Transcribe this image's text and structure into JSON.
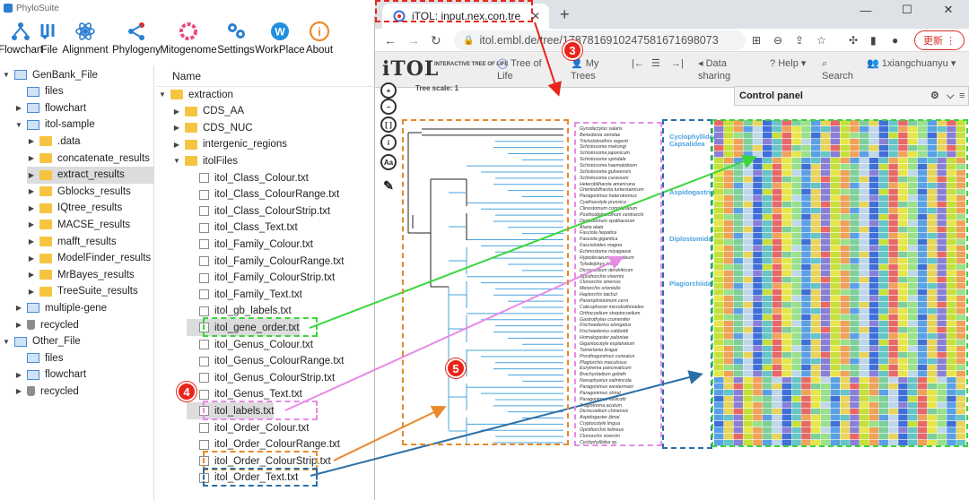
{
  "phylosuite": {
    "title": "PhyloSuite",
    "toolbar": [
      {
        "label": "Flowchart",
        "icon": "flowchart-icon"
      },
      {
        "label": "File",
        "icon": "file-icon"
      },
      {
        "label": "Alignment",
        "icon": "alignment-icon"
      },
      {
        "label": "Phylogeny",
        "icon": "phylogeny-icon"
      },
      {
        "label": "Mitogenome",
        "icon": "mitogenome-icon"
      },
      {
        "label": "Settings",
        "icon": "settings-icon"
      },
      {
        "label": "WorkPlace",
        "icon": "workplace-icon"
      },
      {
        "label": "About",
        "icon": "about-icon"
      }
    ],
    "left_tree": [
      {
        "label": "GenBank_File",
        "level": 0,
        "icon": "db",
        "expanded": true
      },
      {
        "label": "files",
        "level": 1,
        "icon": "grid"
      },
      {
        "label": "flowchart",
        "level": 1,
        "icon": "grid",
        "arrow": "collapsed"
      },
      {
        "label": "itol-sample",
        "level": 1,
        "icon": "grid",
        "expanded": true
      },
      {
        "label": ".data",
        "level": 2,
        "icon": "folder",
        "arrow": "collapsed"
      },
      {
        "label": "concatenate_results",
        "level": 2,
        "icon": "folder",
        "arrow": "collapsed"
      },
      {
        "label": "extract_results",
        "level": 2,
        "icon": "folder",
        "arrow": "collapsed",
        "selected": true
      },
      {
        "label": "Gblocks_results",
        "level": 2,
        "icon": "folder",
        "arrow": "collapsed"
      },
      {
        "label": "IQtree_results",
        "level": 2,
        "icon": "folder",
        "arrow": "collapsed"
      },
      {
        "label": "MACSE_results",
        "level": 2,
        "icon": "folder",
        "arrow": "collapsed"
      },
      {
        "label": "mafft_results",
        "level": 2,
        "icon": "folder",
        "arrow": "collapsed"
      },
      {
        "label": "ModelFinder_results",
        "level": 2,
        "icon": "folder",
        "arrow": "collapsed"
      },
      {
        "label": "MrBayes_results",
        "level": 2,
        "icon": "folder",
        "arrow": "collapsed"
      },
      {
        "label": "TreeSuite_results",
        "level": 2,
        "icon": "folder",
        "arrow": "collapsed"
      },
      {
        "label": "multiple-gene",
        "level": 1,
        "icon": "grid",
        "arrow": "collapsed"
      },
      {
        "label": "recycled",
        "level": 1,
        "icon": "bin",
        "arrow": "collapsed"
      },
      {
        "label": "Other_File",
        "level": 0,
        "icon": "db",
        "expanded": true
      },
      {
        "label": "files",
        "level": 1,
        "icon": "grid"
      },
      {
        "label": "flowchart",
        "level": 1,
        "icon": "grid",
        "arrow": "collapsed"
      },
      {
        "label": "recycled",
        "level": 1,
        "icon": "bin",
        "arrow": "collapsed"
      }
    ],
    "right_header": "Name",
    "right_tree": [
      {
        "label": "extraction",
        "level": 0,
        "icon": "folder",
        "expanded": true
      },
      {
        "label": "CDS_AA",
        "level": 1,
        "icon": "folder",
        "arrow": "collapsed"
      },
      {
        "label": "CDS_NUC",
        "level": 1,
        "icon": "folder",
        "arrow": "collapsed"
      },
      {
        "label": "intergenic_regions",
        "level": 1,
        "icon": "folder",
        "arrow": "collapsed"
      },
      {
        "label": "itolFiles",
        "level": 1,
        "icon": "folder",
        "expanded": true
      },
      {
        "label": "itol_Class_Colour.txt",
        "level": 2,
        "icon": "file"
      },
      {
        "label": "itol_Class_ColourRange.txt",
        "level": 2,
        "icon": "file"
      },
      {
        "label": "itol_Class_ColourStrip.txt",
        "level": 2,
        "icon": "file"
      },
      {
        "label": "itol_Class_Text.txt",
        "level": 2,
        "icon": "file"
      },
      {
        "label": "itol_Family_Colour.txt",
        "level": 2,
        "icon": "file"
      },
      {
        "label": "itol_Family_ColourRange.txt",
        "level": 2,
        "icon": "file"
      },
      {
        "label": "itol_Family_ColourStrip.txt",
        "level": 2,
        "icon": "file"
      },
      {
        "label": "itol_Family_Text.txt",
        "level": 2,
        "icon": "file"
      },
      {
        "label": "itol_gb_labels.txt",
        "level": 2,
        "icon": "file"
      },
      {
        "label": "itol_gene_order.txt",
        "level": 2,
        "icon": "file",
        "selected": true,
        "highlight": "#39d63c"
      },
      {
        "label": "itol_Genus_Colour.txt",
        "level": 2,
        "icon": "file"
      },
      {
        "label": "itol_Genus_ColourRange.txt",
        "level": 2,
        "icon": "file"
      },
      {
        "label": "itol_Genus_ColourStrip.txt",
        "level": 2,
        "icon": "file"
      },
      {
        "label": "itol_Genus_Text.txt",
        "level": 2,
        "icon": "file"
      },
      {
        "label": "itol_labels.txt",
        "level": 2,
        "icon": "file",
        "selected": true,
        "highlight": "#e68be6"
      },
      {
        "label": "itol_Order_Colour.txt",
        "level": 2,
        "icon": "file"
      },
      {
        "label": "itol_Order_ColourRange.txt",
        "level": 2,
        "icon": "file"
      },
      {
        "label": "itol_Order_ColourStrip.txt",
        "level": 2,
        "icon": "file",
        "highlight": "#e8892b"
      },
      {
        "label": "itol_Order_Text.txt",
        "level": 2,
        "icon": "file",
        "highlight": "#2a6fa8"
      }
    ]
  },
  "browser": {
    "tab_title": "iTOL: input.nex.con.tre",
    "url": "itol.embl.de/tree/1787816910247581671698073",
    "update_button": "更新",
    "itol_logo": "iTOL",
    "itol_subtitle": "INTERACTIVE TREE OF LIFE",
    "nav": {
      "tree_of_life": "Tree of Life",
      "my_trees": "My Trees",
      "data_sharing": "Data sharing",
      "help": "Help",
      "search": "Search",
      "user": "1xiangchuanyu"
    },
    "tree_scale": "Tree scale: 1",
    "control_panel": "Control panel"
  },
  "annotations": {
    "circle_3": "3",
    "circle_4": "4",
    "circle_5": "5"
  },
  "accent_colors": {
    "red": "#e8251c",
    "green": "#39d63c",
    "pink": "#e68be6",
    "orange": "#e8892b",
    "blue": "#2a6fa8",
    "clade_blue": "#4aa3df"
  },
  "clade_labels": [
    "Cyclophyllidea",
    "Capsalidea",
    "Aspidogastrida",
    "Diplostomida",
    "Plagiorchiida"
  ],
  "taxa": [
    "Gyrodactylus salaris",
    "Benedenia seriolae",
    "Tricholobrothrix regenti",
    "Schistosoma mekongi",
    "Schistosoma japonicum",
    "Schistosoma spindale",
    "Schistosoma haematobium",
    "Schistosoma guineensis",
    "Schistosoma curassoni",
    "Heterobilharzia americana",
    "Orientobilharzia turkestanicum",
    "Paragonimus heterotremus",
    "Cyathocotyle prussica",
    "Clinostomum complanatum",
    "Posthodiplostomum centrarchi",
    "Diplostomum spathaceum",
    "Alaria alata",
    "Fasciola hepatica",
    "Fasciola gigantica",
    "Fascioloides magna",
    "Echinostoma miyagawai",
    "Hypoderaeum conoideum",
    "Tylodelphys immer",
    "Dicrocoelium dendriticum",
    "Opisthorchis viverrini",
    "Clonorchis sinensis",
    "Metorchis orientalis",
    "Haplorchis taichui",
    "Paramphistomum cervi",
    "Calicophoron microbothrioides",
    "Orthocoelium streptocoelium",
    "Gastrothylax crumenifer",
    "Fischoederius elongatus",
    "Fischoederius cobboldi",
    "Homalogaster paloniae",
    "Gigantocotyle explanatum",
    "Tamerlania bragai",
    "Prosthogonimus cuneatus",
    "Plagiorchis maculosus",
    "Eurytrema pancreaticum",
    "Brachycladium goliath",
    "Nanophyetus salmincola",
    "Paragonimus westermani",
    "Paragonimus ohirai",
    "Paragonimus kellicotti",
    "Troglotrema acutum",
    "Dicrocoelium chinensis",
    "Aspidogaster ijimai",
    "Cryptocotyle lingua",
    "Opisthorchis felineus",
    "Clonorchis viverrini",
    "Cyclophyllidea sp."
  ]
}
